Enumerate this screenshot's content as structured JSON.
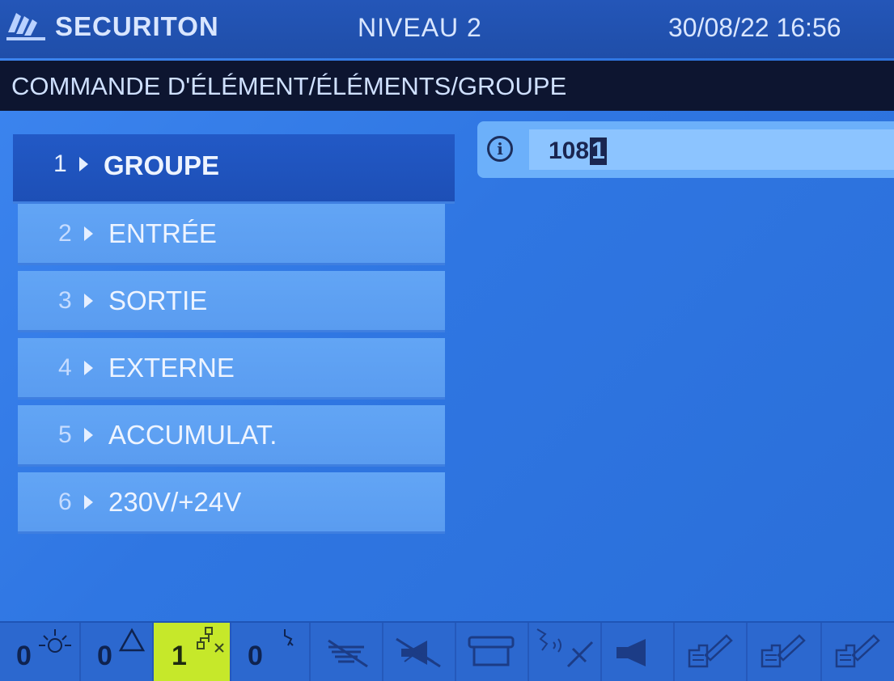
{
  "header": {
    "brand": "SECURITON",
    "level": "NIVEAU  2",
    "datetime": "30/08/22 16:56"
  },
  "breadcrumb": "COMMANDE D'ÉLÉMENT/ÉLÉMENTS/GROUPE",
  "menu": {
    "selected_index": 0,
    "items": [
      {
        "num": "1",
        "label": "GROUPE"
      },
      {
        "num": "2",
        "label": "ENTRÉE"
      },
      {
        "num": "3",
        "label": "SORTIE"
      },
      {
        "num": "4",
        "label": "EXTERNE"
      },
      {
        "num": "5",
        "label": "ACCUMULAT."
      },
      {
        "num": "6",
        "label": "230V/+24V"
      }
    ]
  },
  "group_field": {
    "icon": "info-icon",
    "value": "108",
    "cursor_char": "1"
  },
  "status_bar": {
    "counters": [
      {
        "icon": "alarm-light-icon",
        "count": "0"
      },
      {
        "icon": "warning-triangle-icon",
        "count": "0"
      },
      {
        "icon": "network-fault-icon",
        "count": "1",
        "active": true
      },
      {
        "icon": "antenna-icon",
        "count": "0"
      }
    ],
    "icons": [
      "disabled-detector-icon",
      "muted-horn-icon",
      "printer-icon",
      "transmission-off-icon",
      "horn-icon",
      "hand-pencil-icon-1",
      "hand-pencil-icon-2",
      "hand-pencil-icon-3"
    ],
    "active_color": "#c6e82a"
  }
}
